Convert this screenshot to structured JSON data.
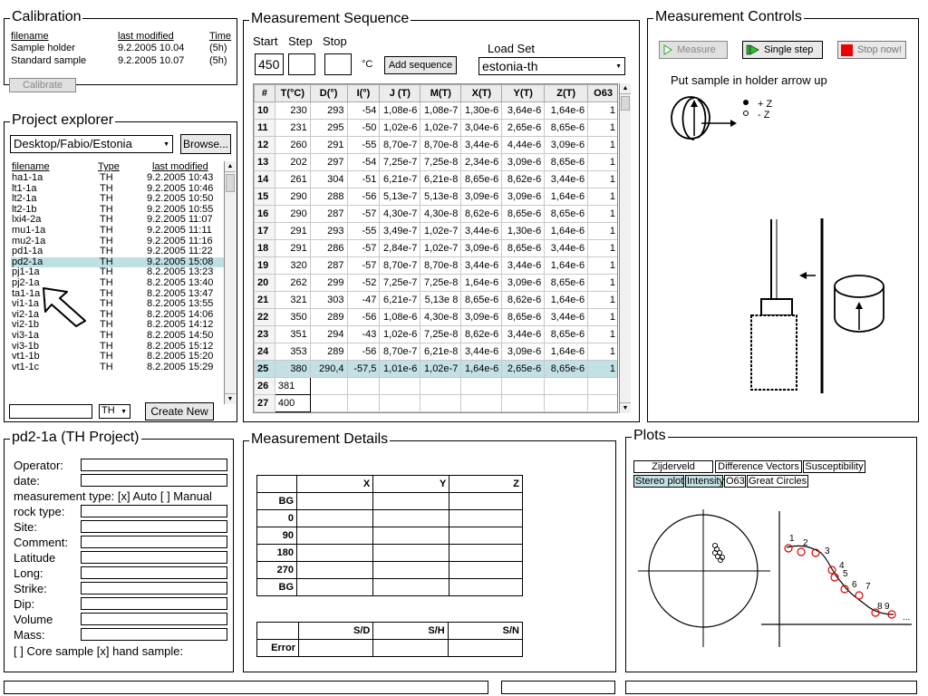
{
  "calibration": {
    "title": "Calibration",
    "headers": {
      "filename": "filename",
      "last_modified": "last modified",
      "time": "Time"
    },
    "rows": [
      {
        "filename": "Sample holder",
        "modified": "9.2.2005 10.04",
        "time": "(5h)"
      },
      {
        "filename": "Standard sample",
        "modified": "9.2.2005 10.07",
        "time": "(5h)"
      }
    ],
    "button": "Calibrate"
  },
  "project_explorer": {
    "title": "Project explorer",
    "path": "Desktop/Fabio/Estonia",
    "browse": "Browse...",
    "headers": {
      "filename": "filename",
      "type": "Type",
      "modified": "last modified"
    },
    "files": [
      {
        "name": "ha1-1a",
        "type": "TH",
        "modified": "9.2.2005 10:43"
      },
      {
        "name": "lt1-1a",
        "type": "TH",
        "modified": "9.2.2005 10:46"
      },
      {
        "name": "lt2-1a",
        "type": "TH",
        "modified": "9.2.2005 10:50"
      },
      {
        "name": "lt2-1b",
        "type": "TH",
        "modified": "9.2.2005 10:55"
      },
      {
        "name": "lxi4-2a",
        "type": "TH",
        "modified": "9.2.2005 11:07"
      },
      {
        "name": "mu1-1a",
        "type": "TH",
        "modified": "9.2.2005 11:11"
      },
      {
        "name": "mu2-1a",
        "type": "TH",
        "modified": "9.2.2005 11:16"
      },
      {
        "name": "pd1-1a",
        "type": "TH",
        "modified": "9.2.2005 11:22"
      },
      {
        "name": "pd2-1a",
        "type": "TH",
        "modified": "9.2.2005 15:08"
      },
      {
        "name": "pj1-1a",
        "type": "TH",
        "modified": "8.2.2005 13:23"
      },
      {
        "name": "pj2-1a",
        "type": "TH",
        "modified": "8.2.2005 13:40"
      },
      {
        "name": "ta1-1a",
        "type": "TH",
        "modified": "8.2.2005 13:47"
      },
      {
        "name": "vi1-1a",
        "type": "TH",
        "modified": "8.2.2005 13:55"
      },
      {
        "name": "vi2-1a",
        "type": "TH",
        "modified": "8.2.2005 14:06"
      },
      {
        "name": "vi2-1b",
        "type": "TH",
        "modified": "8.2.2005 14:12"
      },
      {
        "name": "vi3-1a",
        "type": "TH",
        "modified": "8.2.2005 14:50"
      },
      {
        "name": "vi3-1b",
        "type": "TH",
        "modified": "8.2.2005 15:12"
      },
      {
        "name": "vt1-1b",
        "type": "TH",
        "modified": "8.2.2005 15:20"
      },
      {
        "name": "vt1-1c",
        "type": "TH",
        "modified": "8.2.2005 15:29"
      }
    ],
    "selected_index": 8,
    "new_type": "TH",
    "create_button": "Create New"
  },
  "sequence": {
    "title": "Measurement Sequence",
    "start_label": "Start",
    "step_label": "Step",
    "stop_label": "Stop",
    "start_value": "450",
    "unit": "°C",
    "add_button": "Add sequence",
    "load_label": "Load Set",
    "load_value": "estonia-th",
    "columns": [
      "#",
      "T(°C)",
      "D(°)",
      "I(°)",
      "J (T)",
      "M(T)",
      "X(T)",
      "Y(T)",
      "Z(T)",
      "O63"
    ],
    "rows": [
      [
        "10",
        "230",
        "293",
        "-54",
        "1,08e-6",
        "1,08e-7",
        "1,30e-6",
        "3,64e-6",
        "1,64e-6",
        "1"
      ],
      [
        "11",
        "231",
        "295",
        "-50",
        "1,02e-6",
        "1,02e-7",
        "3,04e-6",
        "2,65e-6",
        "8,65e-6",
        "1"
      ],
      [
        "12",
        "260",
        "291",
        "-55",
        "8,70e-7",
        "8,70e-8",
        "3,44e-6",
        "4,44e-6",
        "3,09e-6",
        "1"
      ],
      [
        "13",
        "202",
        "297",
        "-54",
        "7,25e-7",
        "7,25e-8",
        "2,34e-6",
        "3,09e-6",
        "8,65e-6",
        "1"
      ],
      [
        "14",
        "261",
        "304",
        "-51",
        "6,21e-7",
        "6,21e-8",
        "8,65e-6",
        "8,62e-6",
        "3,44e-6",
        "1"
      ],
      [
        "15",
        "290",
        "288",
        "-56",
        "5,13e-7",
        "5,13e-8",
        "3,09e-6",
        "3,09e-6",
        "1,64e-6",
        "1"
      ],
      [
        "16",
        "290",
        "287",
        "-57",
        "4,30e-7",
        "4,30e-8",
        "8,62e-6",
        "8,65e-6",
        "8,65e-6",
        "1"
      ],
      [
        "17",
        "291",
        "293",
        "-55",
        "3,49e-7",
        "1,02e-7",
        "3,44e-6",
        "1,30e-6",
        "1,64e-6",
        "1"
      ],
      [
        "18",
        "291",
        "286",
        "-57",
        "2,84e-7",
        "1,02e-7",
        "3,09e-6",
        "8,65e-6",
        "3,44e-6",
        "1"
      ],
      [
        "19",
        "320",
        "287",
        "-57",
        "8,70e-7",
        "8,70e-8",
        "3,44e-6",
        "3,44e-6",
        "1,64e-6",
        "1"
      ],
      [
        "20",
        "262",
        "299",
        "-52",
        "7,25e-7",
        "7,25e-8",
        "1,64e-6",
        "3,09e-6",
        "8,65e-6",
        "1"
      ],
      [
        "21",
        "321",
        "303",
        "-47",
        "6,21e-7",
        "5,13e 8",
        "8,65e-6",
        "8,62e-6",
        "1,64e-6",
        "1"
      ],
      [
        "22",
        "350",
        "289",
        "-56",
        "1,08e-6",
        "4,30e-8",
        "3,09e-6",
        "8,65e-6",
        "3,44e-6",
        "1"
      ],
      [
        "23",
        "351",
        "294",
        "-43",
        "1,02e-6",
        "7,25e-8",
        "8,62e-6",
        "3,44e-6",
        "8,65e-6",
        "1"
      ],
      [
        "24",
        "353",
        "289",
        "-56",
        "8,70e-7",
        "6,21e-8",
        "3,44e-6",
        "3,09e-6",
        "1,64e-6",
        "1"
      ],
      [
        "25",
        "380",
        "290,4",
        "-57,5",
        "1,01e-6",
        "1,02e-7",
        "1,64e-6",
        "2,65e-6",
        "8,65e-6",
        "1"
      ],
      [
        "26",
        "381",
        "",
        "",
        "",
        "",
        "",
        "",
        "",
        ""
      ],
      [
        "27",
        "400",
        "",
        "",
        "",
        "",
        "",
        "",
        "",
        ""
      ]
    ],
    "highlight_row": 15
  },
  "controls": {
    "title": "Measurement Controls",
    "measure": "Measure",
    "single_step": "Single step",
    "stop_now": "Stop now!",
    "instruction": "Put sample in holder arrow up",
    "plus_z": "+ Z",
    "minus_z": "- Z"
  },
  "project": {
    "title": "pd2-1a (TH Project)",
    "operator": "Operator:",
    "date": "date:",
    "measurement_type": "measurement type: [x] Auto [ ] Manual",
    "rock_type": "rock type:",
    "site": "Site:",
    "comment": "Comment:",
    "latitude": "Latitude",
    "long": "Long:",
    "strike": "Strike:",
    "dip": "Dip:",
    "volume": "Volume",
    "mass": "Mass:",
    "sample_kind": "[ ] Core sample [x]  hand sample:"
  },
  "details": {
    "title": "Measurement Details",
    "cols": [
      "X",
      "Y",
      "Z"
    ],
    "rows": [
      "BG",
      "0",
      "90",
      "180",
      "270",
      "BG"
    ],
    "err_cols": [
      "S/D",
      "S/H",
      "S/N"
    ],
    "err_row": "Error"
  },
  "plots": {
    "title": "Plots",
    "tabs_row1": [
      "Zijderveld",
      "Difference Vectors",
      "Susceptibility"
    ],
    "tabs_row2": [
      "Stereo plot",
      "Intensity",
      "O63",
      "Great Circles"
    ],
    "active_tabs": [
      "Stereo plot",
      "Intensity"
    ],
    "point_labels": [
      "1",
      "2",
      "3",
      "4",
      "5",
      "6",
      "7",
      "8",
      "9"
    ],
    "more": "..."
  }
}
